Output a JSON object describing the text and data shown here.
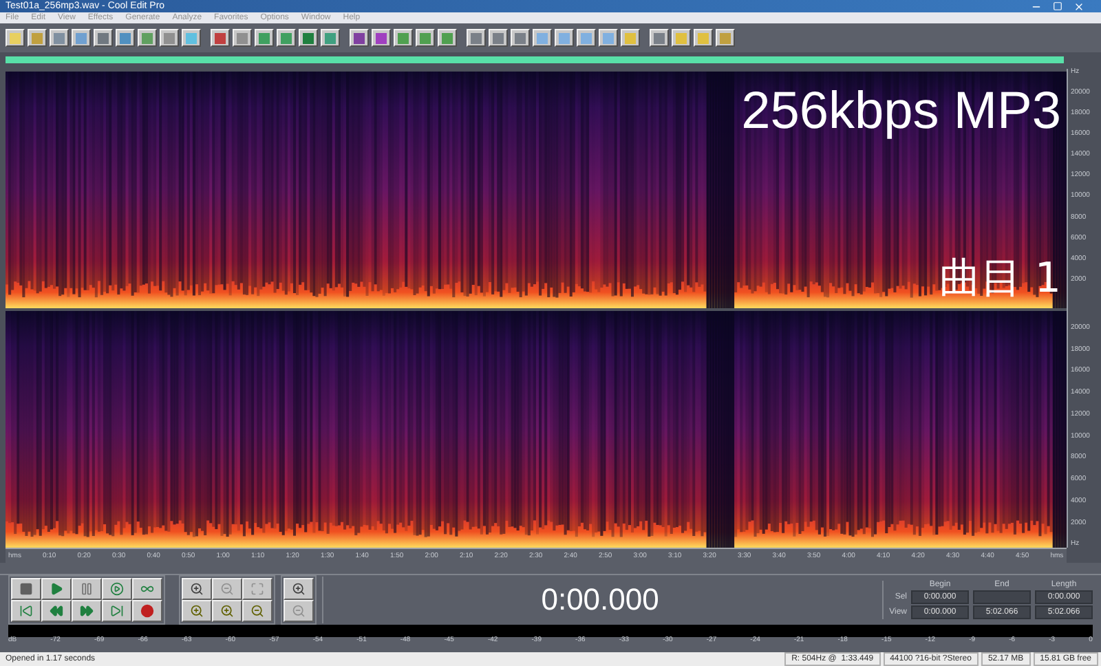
{
  "window": {
    "title": "Test01a_256mp3.wav - Cool Edit Pro"
  },
  "menu": [
    "File",
    "Edit",
    "View",
    "Effects",
    "Generate",
    "Analyze",
    "Favorites",
    "Options",
    "Window",
    "Help"
  ],
  "channels": [
    {
      "overlays": [
        "256kbps MP3",
        "曲目 1"
      ],
      "freq_labels": [
        "Hz",
        "20000",
        "18000",
        "16000",
        "14000",
        "12000",
        "10000",
        "8000",
        "6000",
        "4000",
        "2000"
      ]
    },
    {
      "freq_labels": [
        "20000",
        "18000",
        "16000",
        "14000",
        "12000",
        "10000",
        "8000",
        "6000",
        "4000",
        "2000",
        "Hz"
      ]
    }
  ],
  "time_ruler": [
    "hms",
    "0:10",
    "0:20",
    "0:30",
    "0:40",
    "0:50",
    "1:00",
    "1:10",
    "1:20",
    "1:30",
    "1:40",
    "1:50",
    "2:00",
    "2:10",
    "2:20",
    "2:30",
    "2:40",
    "2:50",
    "3:00",
    "3:10",
    "3:20",
    "3:30",
    "3:40",
    "3:50",
    "4:00",
    "4:10",
    "4:20",
    "4:30",
    "4:40",
    "4:50",
    "hms"
  ],
  "time_display": "0:00.000",
  "selection": {
    "headers": [
      "Begin",
      "End",
      "Length"
    ],
    "rows": [
      {
        "label": "Sel",
        "begin": "0:00.000",
        "length": "0:00.000"
      },
      {
        "label": "View",
        "begin": "0:00.000",
        "end": "5:02.066",
        "length": "5:02.066"
      }
    ]
  },
  "meter_ticks": [
    "dB",
    "-72",
    "-69",
    "-66",
    "-63",
    "-60",
    "-57",
    "-54",
    "-51",
    "-48",
    "-45",
    "-42",
    "-39",
    "-36",
    "-33",
    "-30",
    "-27",
    "-24",
    "-21",
    "-18",
    "-15",
    "-12",
    "-9",
    "-6",
    "-3",
    "0"
  ],
  "status_bar": [
    "Opened in 1.17 seconds",
    "R: 504Hz @  1:33.449",
    "44100 ?16-bit ?Stereo",
    "52.17 MB",
    "15.81 GB free"
  ]
}
